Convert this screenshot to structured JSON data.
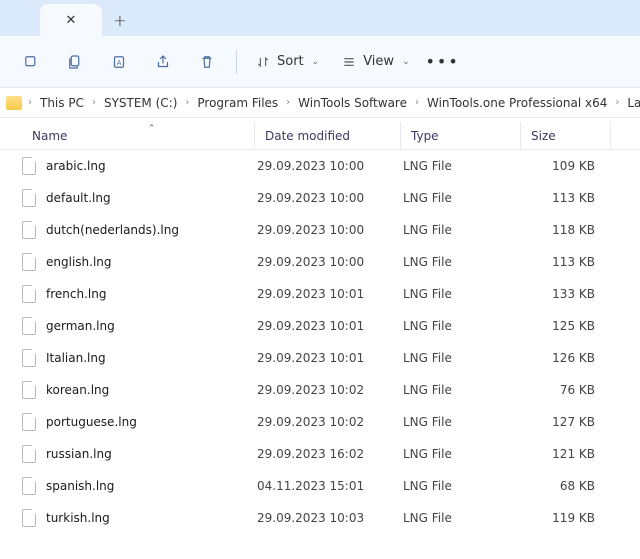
{
  "toolbar": {
    "sort_label": "Sort",
    "view_label": "View"
  },
  "breadcrumbs": [
    "This PC",
    "SYSTEM (C:)",
    "Program Files",
    "WinTools Software",
    "WinTools.one Professional x64",
    "Lang"
  ],
  "columns": {
    "name": "Name",
    "date": "Date modified",
    "type": "Type",
    "size": "Size"
  },
  "files": [
    {
      "name": "arabic.lng",
      "date": "29.09.2023 10:00",
      "type": "LNG File",
      "size": "109 KB"
    },
    {
      "name": "default.lng",
      "date": "29.09.2023 10:00",
      "type": "LNG File",
      "size": "113 KB"
    },
    {
      "name": "dutch(nederlands).lng",
      "date": "29.09.2023 10:00",
      "type": "LNG File",
      "size": "118 KB"
    },
    {
      "name": "english.lng",
      "date": "29.09.2023 10:00",
      "type": "LNG File",
      "size": "113 KB"
    },
    {
      "name": "french.lng",
      "date": "29.09.2023 10:01",
      "type": "LNG File",
      "size": "133 KB"
    },
    {
      "name": "german.lng",
      "date": "29.09.2023 10:01",
      "type": "LNG File",
      "size": "125 KB"
    },
    {
      "name": "Italian.lng",
      "date": "29.09.2023 10:01",
      "type": "LNG File",
      "size": "126 KB"
    },
    {
      "name": "korean.lng",
      "date": "29.09.2023 10:02",
      "type": "LNG File",
      "size": "76 KB"
    },
    {
      "name": "portuguese.lng",
      "date": "29.09.2023 10:02",
      "type": "LNG File",
      "size": "127 KB"
    },
    {
      "name": "russian.lng",
      "date": "29.09.2023 16:02",
      "type": "LNG File",
      "size": "121 KB"
    },
    {
      "name": "spanish.lng",
      "date": "04.11.2023 15:01",
      "type": "LNG File",
      "size": "68 KB"
    },
    {
      "name": "turkish.lng",
      "date": "29.09.2023 10:03",
      "type": "LNG File",
      "size": "119 KB"
    }
  ]
}
